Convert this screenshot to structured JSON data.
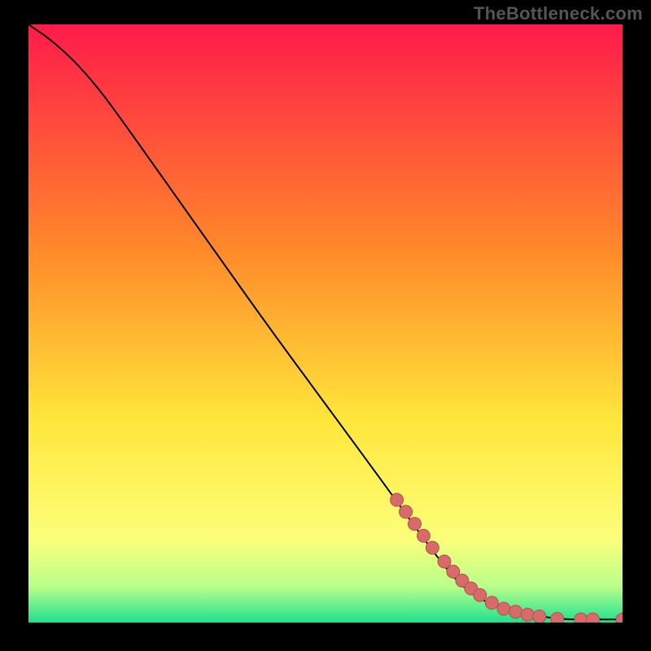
{
  "watermark": "TheBottleneck.com",
  "colors": {
    "gradient_top": "#ff1a4b",
    "gradient_mid1": "#ff8a2a",
    "gradient_mid2": "#ffe63a",
    "gradient_mid3": "#fcff7a",
    "gradient_bottom_band": "#b9ff8a",
    "gradient_bottom": "#1fe08f",
    "curve": "#000000",
    "marker_fill": "#d86a6a",
    "marker_stroke": "#b25252"
  },
  "chart_data": {
    "type": "line",
    "title": "",
    "xlabel": "",
    "ylabel": "",
    "xlim": [
      0,
      100
    ],
    "ylim": [
      0,
      100
    ],
    "series": [
      {
        "name": "curve",
        "x": [
          0,
          3,
          6,
          9,
          12,
          15,
          20,
          30,
          40,
          50,
          60,
          68,
          72,
          75,
          78,
          82,
          85,
          88,
          90,
          92,
          95,
          100
        ],
        "y": [
          100,
          98,
          95.5,
          92.5,
          89,
          85,
          78,
          64,
          50,
          36.5,
          23,
          12,
          7,
          4.5,
          3,
          1.8,
          1.2,
          0.8,
          0.6,
          0.5,
          0.5,
          0.5
        ]
      }
    ],
    "markers": {
      "name": "highlight-points",
      "x": [
        62,
        63.5,
        65,
        66.5,
        68,
        70,
        71.5,
        73,
        74.5,
        76,
        78,
        80,
        82,
        84,
        86,
        89,
        93,
        95,
        100
      ],
      "y": [
        20.5,
        18.5,
        16.5,
        14.5,
        12.5,
        10.2,
        8.5,
        7.0,
        5.7,
        4.6,
        3.3,
        2.3,
        1.8,
        1.3,
        1.0,
        0.6,
        0.5,
        0.5,
        0.5
      ]
    }
  }
}
